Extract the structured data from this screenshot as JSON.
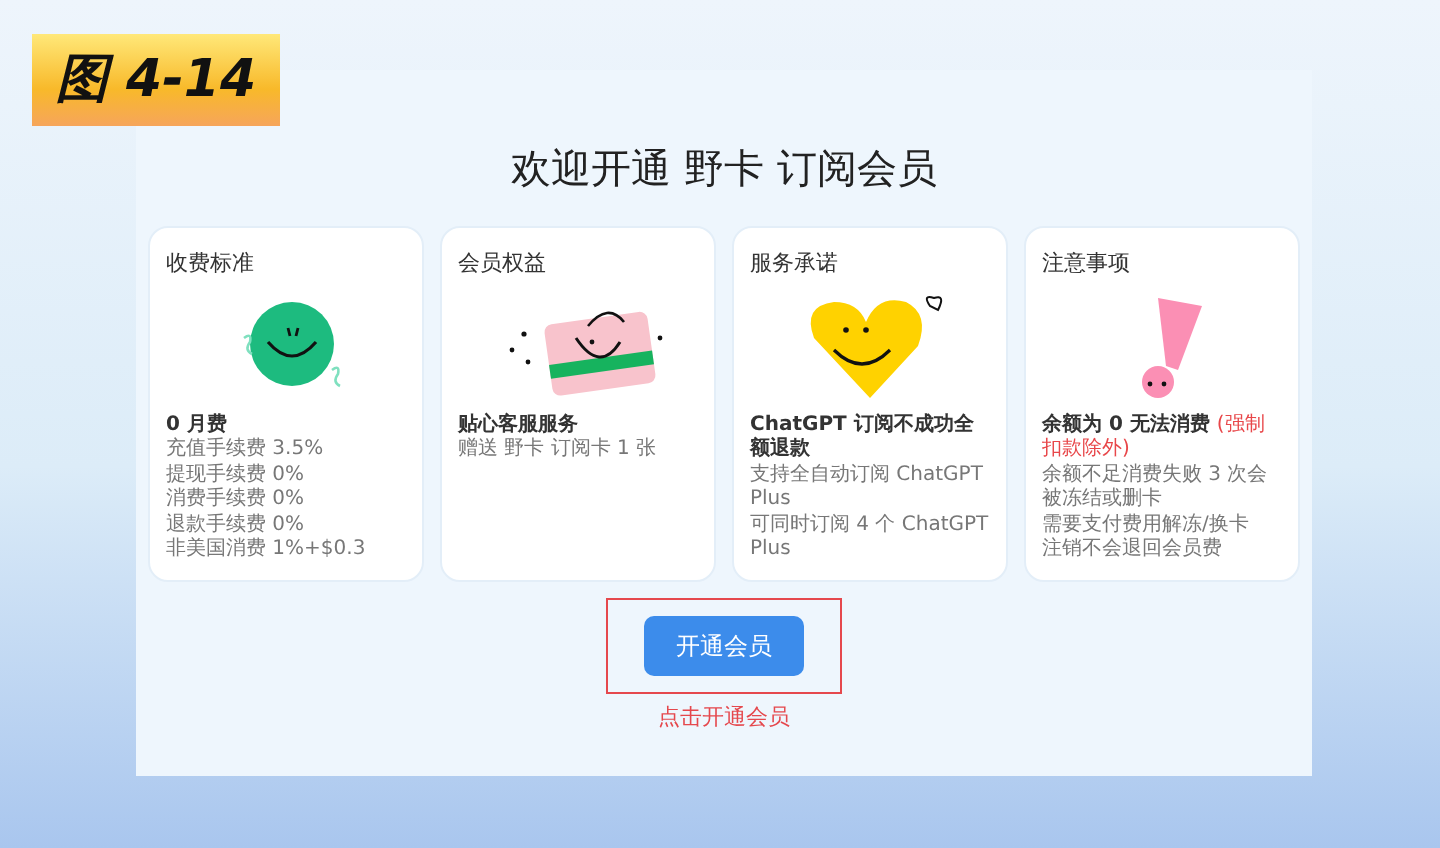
{
  "figure_label": "图 4-14",
  "heading": "欢迎开通 野卡 订阅会员",
  "cards": [
    {
      "title": "收费标准",
      "kind": "coin",
      "headline": "0 月费",
      "lines": [
        "充值手续费 3.5%",
        "提现手续费 0%",
        "消费手续费 0%",
        "退款手续费 0%",
        "非美国消费 1%+$0.3"
      ]
    },
    {
      "title": "会员权益",
      "kind": "card",
      "headline": "贴心客服服务",
      "lines": [
        "赠送 野卡 订阅卡 1 张"
      ]
    },
    {
      "title": "服务承诺",
      "kind": "heart",
      "headline": "ChatGPT 订阅不成功全额退款",
      "lines": [
        "支持全自动订阅 ChatGPT Plus",
        "可同时订阅 4 个 ChatGPT Plus"
      ]
    },
    {
      "title": "注意事项",
      "kind": "exclaim",
      "headline": "余额为 0 无法消费",
      "note": "(强制扣款除外)",
      "lines": [
        "余额不足消费失败 3 次会被冻结或删卡",
        "需要支付费用解冻/换卡",
        "注销不会退回会员费"
      ]
    }
  ],
  "button": {
    "label": "开通会员",
    "highlighted": true
  },
  "caption": "点击开通会员"
}
